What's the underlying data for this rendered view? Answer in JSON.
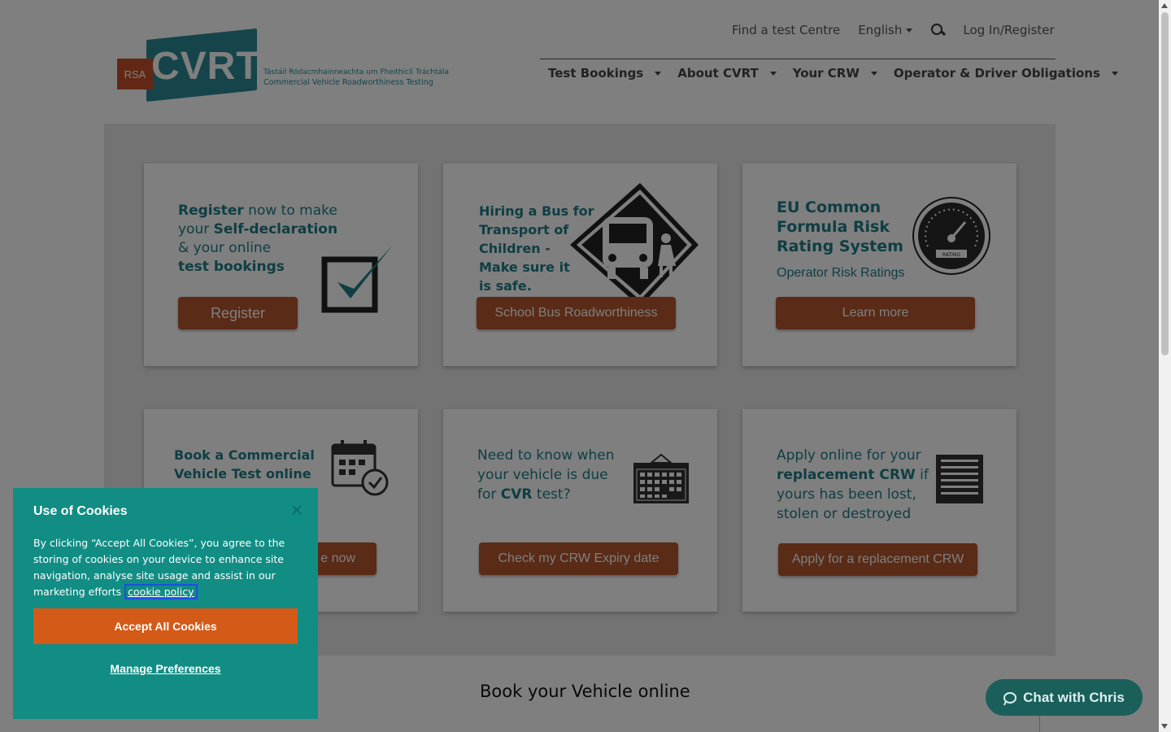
{
  "header": {
    "logo_text": "CVRT",
    "logo_badge": "RSA",
    "logo_sub_irish": "Tástáil Ródacmhainneachta um Fheithiclí Tráchtála",
    "logo_sub_english": "Commercial Vehicle Roadworthiness Testing",
    "util_nav": {
      "find_centre": "Find a test Centre",
      "language": "English",
      "login": "Log In/Register"
    },
    "main_nav": [
      {
        "label": "Test Bookings"
      },
      {
        "label": "About CVRT"
      },
      {
        "label": "Your CRW"
      },
      {
        "label": "Operator & Driver Obligations"
      }
    ]
  },
  "cards": {
    "register": {
      "line1_bold": "Register",
      "line1_rest": " now to make",
      "line2_pre": "your ",
      "line2_bold": "Self-declaration",
      "line3": "& your online",
      "line4": "test bookings",
      "button": "Register"
    },
    "bus": {
      "text": [
        "Hiring a Bus for",
        "Transport of",
        "Children -",
        "Make sure it",
        "is safe."
      ],
      "button": "School Bus Roadworthiness"
    },
    "risk": {
      "title": [
        "EU Common",
        "Formula Risk",
        "Rating System"
      ],
      "subtitle": "Operator Risk Ratings",
      "gauge_label": "RATING",
      "button": "Learn more"
    },
    "book": {
      "text": [
        "Book a Commercial",
        "Vehicle Test online"
      ],
      "button_visible": "e now"
    },
    "expiry": {
      "line1": "Need to know when",
      "line2": "your vehicle is due",
      "line3_pre": "for ",
      "line3_bold": "CVR",
      "line3_post": " test?",
      "button": "Check my CRW Expiry date"
    },
    "replace": {
      "line1": "Apply online for your",
      "line2_bold": "replacement CRW",
      "line2_post": " if",
      "line3": "yours has been lost,",
      "line4": "stolen or destroyed",
      "button": "Apply for a replacement CRW"
    }
  },
  "section_title": "Book your Vehicle online",
  "cookie": {
    "title": "Use of Cookies",
    "body": "By clicking “Accept All Cookies”, you agree to the storing of cookies on your device to enhance site navigation, analyse site usage and assist in our marketing efforts",
    "link": "cookie policy",
    "accept": "Accept All Cookies",
    "manage": "Manage Preferences"
  },
  "chat": {
    "label": "Chat with Chris"
  },
  "colors": {
    "teal": "#1f7d87",
    "button_brown": "#b4562d",
    "cookie_bg": "#118d84",
    "accept_orange": "#d45a18",
    "chat_bg": "#1b5f5b"
  }
}
